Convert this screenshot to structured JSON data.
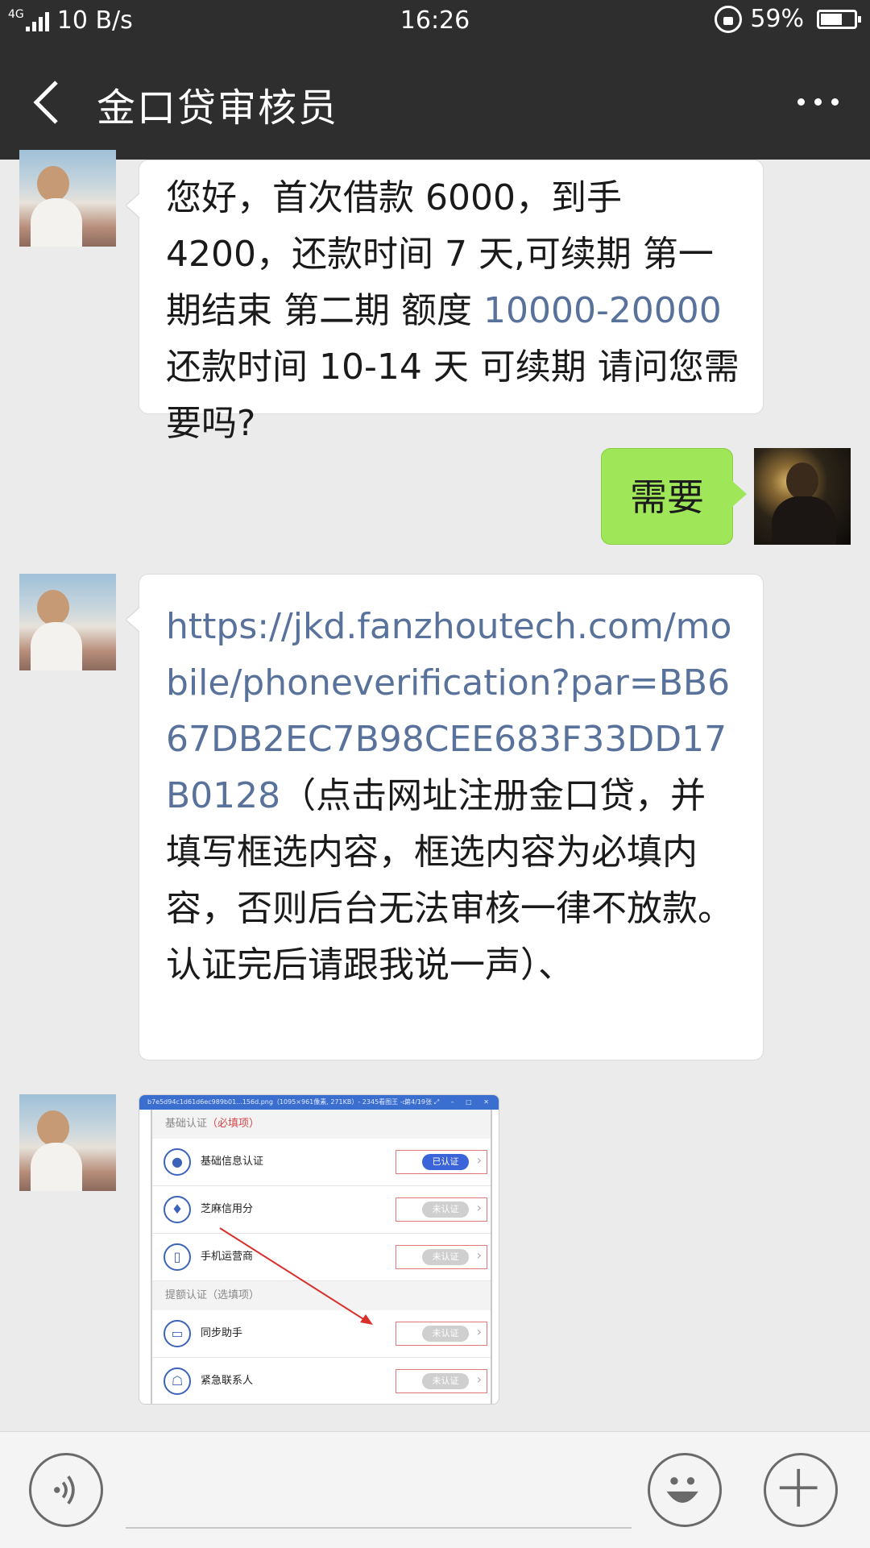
{
  "status_bar": {
    "network": "4G",
    "speed": "10 B/s",
    "time": "16:26",
    "battery": "59%"
  },
  "header": {
    "title": "金口贷审核员",
    "back_icon": "chevron-left-icon",
    "more_icon": "more-dots-icon"
  },
  "messages": [
    {
      "side": "left",
      "type": "text",
      "parts": [
        {
          "text": "您好，首次借款 6000，到手 4200，还款时间 7 天,可续期 第一期结束 第二期 额度 ",
          "link": false
        },
        {
          "text": "10000-20000",
          "link": true
        },
        {
          "text": "  还款时间 10-14 天 可续期 请问您需要吗?",
          "link": false
        }
      ]
    },
    {
      "side": "right",
      "type": "text",
      "text": "需要"
    },
    {
      "side": "left",
      "type": "text",
      "parts": [
        {
          "text": "https://jkd.fanzhoutech.com/mobile/phoneverification?par=BB667DB2EC7B98CEE683F33DD17B0128",
          "link": true
        },
        {
          "text": "（点击网址注册金口贷，并填写框选内容，框选内容为必填内容，否则后台无法审核一律不放款。认证完后请跟我说一声）、",
          "link": false
        }
      ]
    },
    {
      "side": "left",
      "type": "image",
      "image": {
        "window_title": "b7e5d94c1d61d6ec989b01...156d.png（1095×961像素, 271KB）- 2345看图王 - 第4/19张",
        "section1": {
          "title": "基础认证",
          "suffix": "（必填项）"
        },
        "section2": {
          "title": "提额认证",
          "suffix": "（选填项）"
        },
        "rows": [
          {
            "label": "基础信息认证",
            "status": "已认证",
            "icon": "user-icon",
            "done": true
          },
          {
            "label": "芝麻信用分",
            "status": "未认证",
            "icon": "flame-icon",
            "done": false
          },
          {
            "label": "手机运营商",
            "status": "未认证",
            "icon": "phone-icon",
            "done": false
          },
          {
            "label": "同步助手",
            "status": "未认证",
            "icon": "book-icon",
            "done": false
          },
          {
            "label": "紧急联系人",
            "status": "未认证",
            "icon": "contact-icon",
            "done": false
          }
        ]
      }
    }
  ],
  "input_bar": {
    "voice_icon": "voice-icon",
    "emoji_icon": "emoji-icon",
    "plus_icon": "plus-icon",
    "placeholder": ""
  },
  "colors": {
    "header_bg": "#2e2e2e",
    "chat_bg": "#ebebeb",
    "sent_bubble": "#9fe658",
    "link": "#58729b"
  }
}
